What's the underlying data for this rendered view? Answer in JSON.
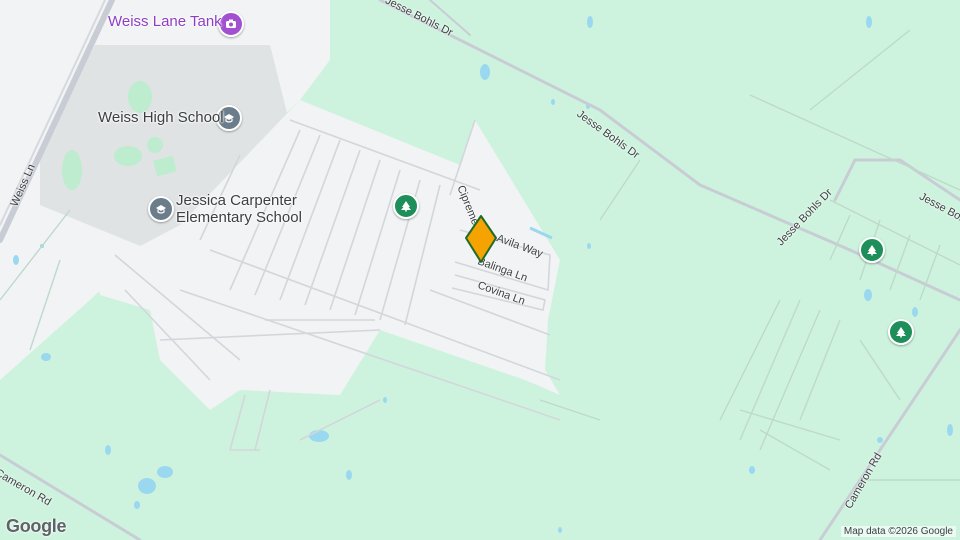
{
  "pois": {
    "weiss_lane_tank": "Weiss Lane Tank",
    "weiss_high_school": "Weiss High School",
    "jessica_carpenter_line1": "Jessica Carpenter",
    "jessica_carpenter_line2": "Elementary School"
  },
  "roads": {
    "jesse_bohls_top": "Jesse Bohls Dr",
    "jesse_bohls_mid": "Jesse Bohls Dr",
    "jesse_bohls_right": "Jesse Bohls Dr",
    "jesse_bohls_edge": "Jesse Bohls Dr",
    "weiss_ln": "Weiss Ln",
    "cameron_rd_left": "Cameron Rd",
    "cameron_rd_right": "Cameron Rd",
    "cipreme": "Cipreme",
    "avila_way": "Avila Way",
    "balinga_ln": "Balinga Ln",
    "covina_ln": "Covina Ln"
  },
  "icons": {
    "school": "school-icon",
    "park": "park-icon",
    "camera": "camera-icon",
    "marker": "location-marker-icon"
  },
  "colors": {
    "land": "#cdf3de",
    "urban": "#f1f3f4",
    "school_grounds": "#e0e3e4",
    "road": "#c8ccd4",
    "water": "#9ad8f0",
    "marker": "#f4a300",
    "marker_outline": "#1f6b2c"
  },
  "attribution": "Map data ©2026 Google",
  "logo": "Google"
}
